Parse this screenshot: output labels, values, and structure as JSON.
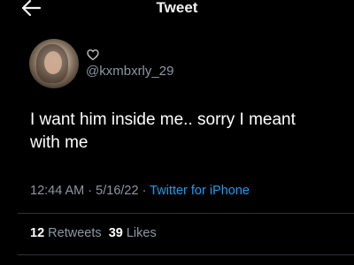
{
  "header": {
    "title": "Tweet",
    "back_icon": "arrow-left-icon"
  },
  "author": {
    "handle": "@kxmbxrly_29",
    "badge_icon": "heart-outline-icon"
  },
  "tweet": {
    "text_line1": "I want him inside me.. sorry I meant",
    "text_line2": "with me",
    "time": "12:44 AM",
    "sep1": " · ",
    "date": "5/16/22",
    "sep2": " · ",
    "source": "Twitter for iPhone"
  },
  "stats": {
    "retweets_count": "12",
    "retweets_label": " Retweets",
    "likes_count": "39",
    "likes_label": " Likes"
  },
  "colors": {
    "background": "#000000",
    "text": "#ffffff",
    "secondary": "#8b98a5",
    "link": "#1d9bf0"
  }
}
